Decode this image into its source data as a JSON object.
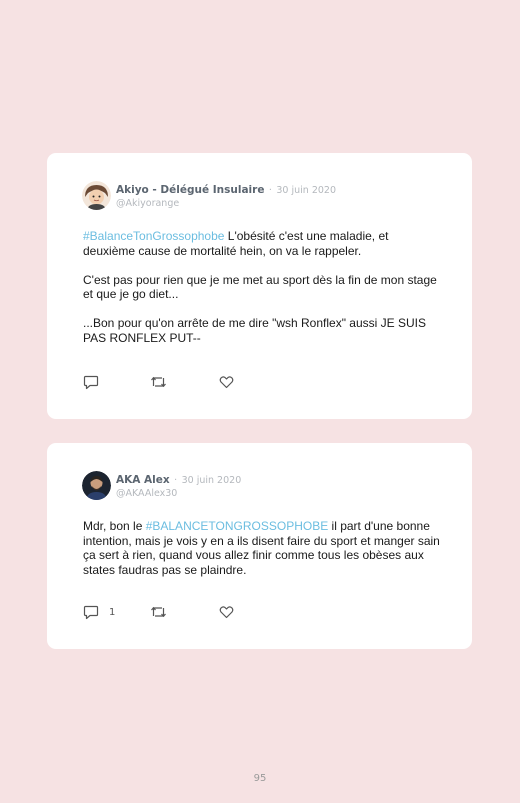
{
  "tweets": [
    {
      "author": "Akiyo - Délégué Insulaire",
      "separator": "·",
      "date": "30 juin 2020",
      "handle": "@Akiyorange",
      "hashtag": "#BalanceTonGrossophobe",
      "line1_rest": " L'obésité c'est une maladie, et deuxième cause de mortalité hein, on va le rappeler.",
      "paragraph2": "C'est pas pour rien que je me met au sport dès la fin de mon stage et que je go diet...",
      "paragraph3": "...Bon pour qu'on arrête de me dire \"wsh Ronflex\" aussi JE SUIS PAS RONFLEX PUT--",
      "reply_count": "",
      "icons": [
        "reply-icon",
        "retweet-icon",
        "like-icon"
      ]
    },
    {
      "author": "AKA Alex",
      "separator": "·",
      "date": "30 juin 2020",
      "handle": "@AKAAlex30",
      "text_before": "Mdr, bon le ",
      "hashtag": "#BALANCETONGROSSOPHOBE",
      "text_after": " il part d'une bonne intention, mais je vois y en a ils disent faire du sport et manger sain ça sert à rien, quand vous allez finir comme tous les obèses aux states faudras pas se plaindre.",
      "reply_count": "1",
      "icons": [
        "reply-icon",
        "retweet-icon",
        "like-icon"
      ]
    }
  ],
  "page_number": "95",
  "colors": {
    "background": "#f6e2e3",
    "card": "#ffffff",
    "hashtag": "#6bbde0",
    "meta": "#b4b8bd",
    "author": "#5b6570"
  }
}
